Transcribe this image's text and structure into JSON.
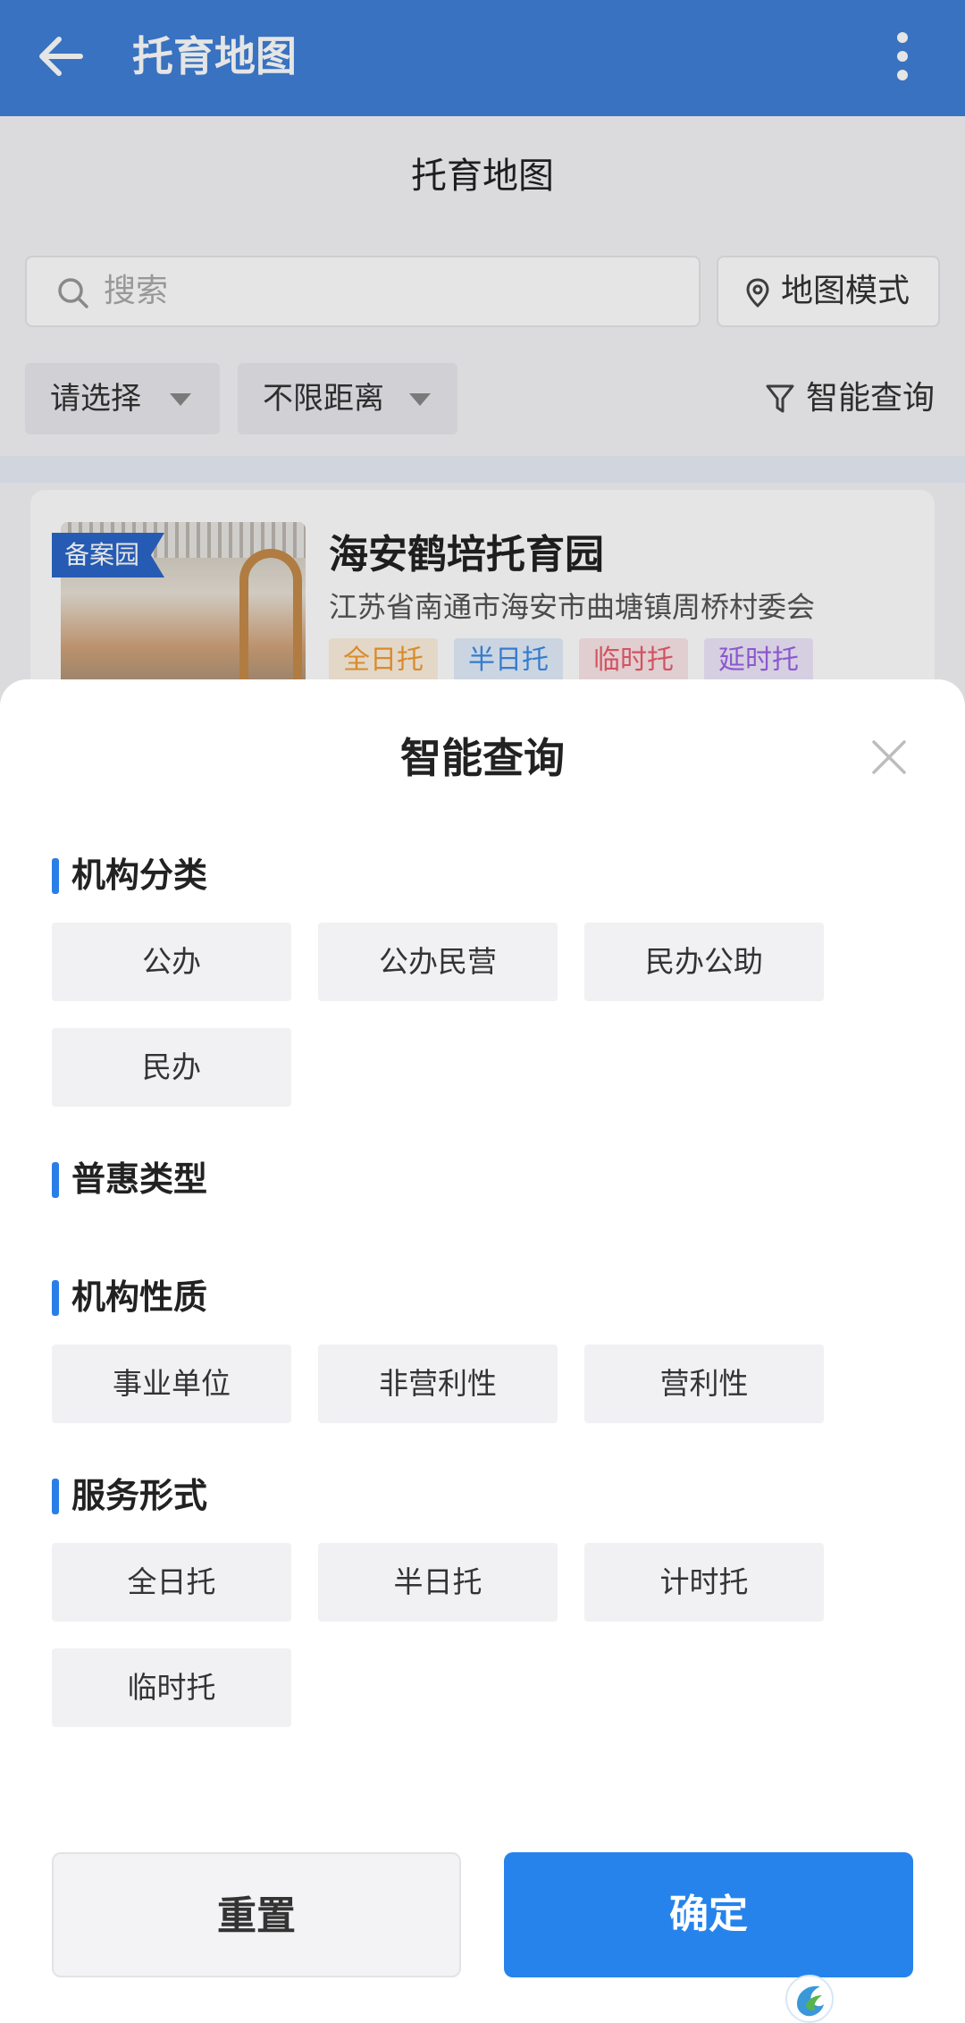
{
  "appbar": {
    "title": "托育地图"
  },
  "page": {
    "title": "托育地图",
    "search_placeholder": "搜索",
    "map_mode": "地图模式",
    "filters": {
      "select": "请选择",
      "distance": "不限距离",
      "smart_query": "智能查询"
    }
  },
  "card": {
    "badge": "备案园",
    "name": "海安鹤培托育园",
    "address": "江苏省南通市海安市曲塘镇周桥村委会",
    "tags": [
      "全日托",
      "半日托",
      "临时托",
      "延时托"
    ]
  },
  "sheet": {
    "title": "智能查询",
    "sections": [
      {
        "label": "机构分类",
        "options": [
          "公办",
          "公办民营",
          "民办公助",
          "民办"
        ]
      },
      {
        "label": "普惠类型",
        "options": []
      },
      {
        "label": "机构性质",
        "options": [
          "事业单位",
          "非营利性",
          "营利性"
        ]
      },
      {
        "label": "服务形式",
        "options": [
          "全日托",
          "半日托",
          "计时托",
          "临时托"
        ]
      }
    ],
    "reset": "重置",
    "confirm": "确定"
  },
  "colors": {
    "appbar": "#3f7fd6",
    "accent": "#2683ec",
    "section_bar": "#2a7ee8"
  }
}
